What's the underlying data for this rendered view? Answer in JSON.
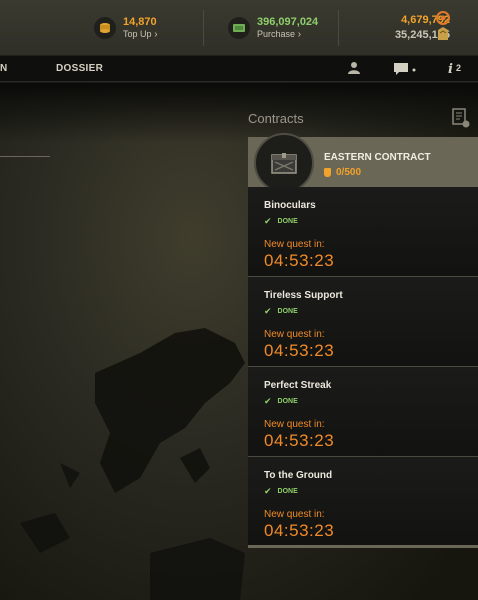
{
  "currency": {
    "gold_amount": "14,870",
    "gold_action": "Top Up",
    "credits_amount": "396,097,024",
    "credits_action": "Purchase",
    "free_xp": "4,679,792",
    "total_xp": "35,245,165"
  },
  "nav": {
    "prev_tab": "N",
    "dossier": "DOSSIER",
    "notifications_count": "2"
  },
  "contracts": {
    "title": "Contracts",
    "contract_name": "EASTERN CONTRACT",
    "progress": "0/500",
    "quests": [
      {
        "name": "Binoculars",
        "status": "DONE",
        "new_label": "New quest in:",
        "timer": "04:53:23"
      },
      {
        "name": "Tireless Support",
        "status": "DONE",
        "new_label": "New quest in:",
        "timer": "04:53:23"
      },
      {
        "name": "Perfect Streak",
        "status": "DONE",
        "new_label": "New quest in:",
        "timer": "04:53:23"
      },
      {
        "name": "To the Ground",
        "status": "DONE",
        "new_label": "New quest in:",
        "timer": "04:53:23"
      }
    ]
  },
  "colors": {
    "accent": "#f2a32b",
    "done": "#8fcf6a",
    "timer": "#f08a28"
  }
}
